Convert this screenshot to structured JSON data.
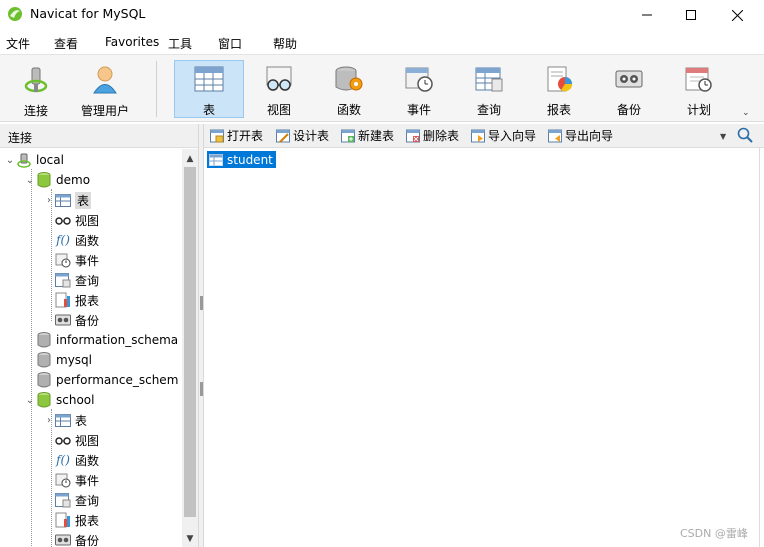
{
  "window": {
    "title": "Navicat for MySQL",
    "app_icon": "navicat-logo-icon",
    "controls": [
      "minimize",
      "maximize",
      "close"
    ]
  },
  "menu": [
    "文件",
    "查看",
    "Favorites",
    "工具",
    "窗口",
    "帮助"
  ],
  "toolbar": {
    "connect": "连接",
    "manage_users": "管理用户",
    "table": "表",
    "view": "视图",
    "function": "函数",
    "event": "事件",
    "query": "查询",
    "report": "报表",
    "backup": "备份",
    "schedule": "计划",
    "active": "表",
    "more": "⌄"
  },
  "left_panel": {
    "header": "连接"
  },
  "tree": {
    "connection": "local",
    "databases": [
      {
        "name": "demo",
        "open": true,
        "children": [
          "表",
          "视图",
          "函数",
          "事件",
          "查询",
          "报表",
          "备份"
        ],
        "selected_child": "表"
      },
      {
        "name": "information_schema",
        "open": false
      },
      {
        "name": "mysql",
        "open": false
      },
      {
        "name": "performance_schem",
        "open": false
      },
      {
        "name": "school",
        "open": true,
        "children": [
          "表",
          "视图",
          "函数",
          "事件",
          "查询",
          "报表",
          "备份"
        ]
      }
    ]
  },
  "object_toolbar": {
    "open_table": "打开表",
    "design_table": "设计表",
    "new_table": "新建表",
    "delete_table": "删除表",
    "import_wizard": "导入向导",
    "export_wizard": "导出向导"
  },
  "objects": [
    {
      "name": "student",
      "selected": true
    }
  ],
  "watermark": "CSDN @雷峰",
  "colors": {
    "selection": "#0078d7",
    "toolbar_active": "#cce4f7",
    "db_open": "#8dc63f",
    "db_closed": "#9e9e9e"
  }
}
